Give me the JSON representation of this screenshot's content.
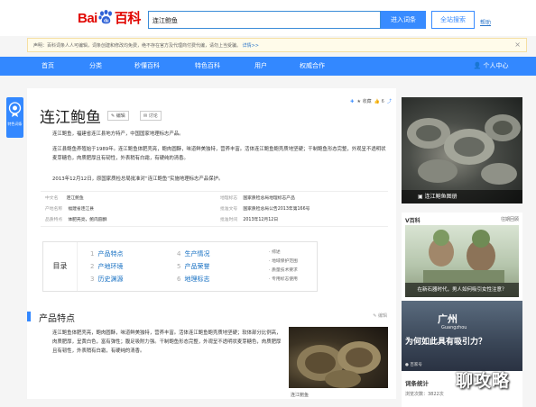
{
  "header": {
    "logo_left": "Bai",
    "logo_right": "百科",
    "search_value": "连江鲍鱼",
    "enter_button": "进入词条",
    "all_search_button": "全站搜索",
    "help_link": "帮助"
  },
  "notice": {
    "text": "声明：百科词条人人可编辑，词条创建和修改均免费，绝不存在官方及代理商付费代编，请勿上当受骗。",
    "more": "详情>>",
    "close": "×"
  },
  "nav": {
    "items": [
      "首页",
      "分类",
      "秒懂百科",
      "特色百科",
      "用户",
      "权威合作"
    ],
    "user": "个人中心"
  },
  "side_tab": {
    "label": "特色词条"
  },
  "entry": {
    "title": "连江鲍鱼",
    "edit_tag": "编辑",
    "discuss_tag": "讨论",
    "actions": {
      "collect": "收藏",
      "like_count": "6"
    },
    "paragraphs": [
      "连江鲍鱼，福建省连江县地方特产，中国国家地理标志产品。",
      "连江县鲍鱼养殖始于1989年。连江鲍鱼体肥壳亮，鲍肉圆酥，味道鲜美独特，营养丰富。活体连江鲍鱼鲍壳质地坚硬；干制鲍鱼形态完整，外观呈不透明状麦芽糖色，肉质肥厚且有韧性，外表稍有白霜，有硬纯的清香。",
      "2013年12月12日，原国家质检总局批准对“连江鲍鱼”实施地理标志产品保护。"
    ]
  },
  "infobox": {
    "left": [
      {
        "key": "中文名",
        "value": "连江鲍鱼"
      },
      {
        "key": "产地名称",
        "value": "福建省连江县"
      },
      {
        "key": "品质特点",
        "value": "体肥壳亮，鲍肉圆酥"
      }
    ],
    "right": [
      {
        "key": "地理标志",
        "value": "国家质检总局地理标志产品"
      },
      {
        "key": "批准文号",
        "value": "国家质检总局公告2013年第166号"
      },
      {
        "key": "批准时间",
        "value": "2013年12月12日"
      }
    ]
  },
  "toc": {
    "label": "目录",
    "items": [
      {
        "num": "1",
        "text": "产品特点"
      },
      {
        "num": "2",
        "text": "产地环境"
      },
      {
        "num": "3",
        "text": "历史渊源"
      },
      {
        "num": "4",
        "text": "生产情况"
      },
      {
        "num": "5",
        "text": "产品荣誉"
      },
      {
        "num": "6",
        "text": "地理标志"
      }
    ],
    "sub_items": [
      "综述",
      "地域保护范围",
      "质量技术要求",
      "专用标志使用"
    ]
  },
  "section1": {
    "title": "产品特点",
    "edit": "编辑",
    "paragraph": "连江鲍鱼体肥壳亮，鲍肉圆酥，味道鲜美独特，营养丰富。活体连江鲍鱼鲍壳质地坚硬；软体部分比例高，肉质肥厚，呈黄白色，富有弹性；腹足吸附力强。干制鲍鱼形态完整，外观呈不透明状麦芽糖色，肉质肥厚且有韧性，外表稍有白霜，有硬纯的清香。",
    "image_caption": "连江鲍鱼"
  },
  "rail": {
    "main_image_caption": "连江鲍鱼图册",
    "video_header": "V百科",
    "video_more": "往期回顾",
    "video_caption": "在新石器时代，男人如何吸引女性注意？",
    "ad_city": "广州",
    "ad_city_en": "Guangzhou",
    "ad_question": "为何如此具有吸引力？",
    "ad_brand": "百家号",
    "stats_title": "词条统计",
    "stats_row": "浏览次数：3822次"
  },
  "watermark": "聊攻略"
}
